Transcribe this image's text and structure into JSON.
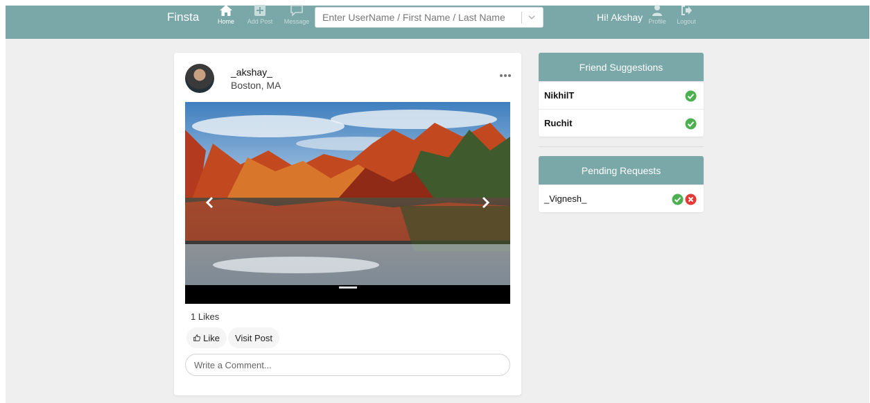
{
  "nav": {
    "brand": "Finsta",
    "items": [
      {
        "label": "Home",
        "icon": "home-icon",
        "active": true
      },
      {
        "label": "Add Post",
        "icon": "plus-square-icon",
        "active": false
      },
      {
        "label": "Message",
        "icon": "message-icon",
        "active": false
      },
      {
        "label": "Profile",
        "icon": "user-icon",
        "active": false
      },
      {
        "label": "Logout",
        "icon": "logout-icon",
        "active": false
      }
    ],
    "search_placeholder": "Enter UserName / First Name / Last Name",
    "greeting": "Hi! Akshay"
  },
  "post": {
    "username": "_akshay_",
    "location": "Boston, MA",
    "likes_text": "1 Likes",
    "like_label": "Like",
    "visit_label": "Visit Post",
    "comment_placeholder": "Write a Comment..."
  },
  "friend_suggestions": {
    "title": "Friend Suggestions",
    "items": [
      {
        "name": "NikhilT"
      },
      {
        "name": "Ruchit"
      }
    ]
  },
  "pending_requests": {
    "title": "Pending Requests",
    "items": [
      {
        "name": "_Vignesh_"
      }
    ]
  },
  "colors": {
    "navbar": "#7aa7a8",
    "accept": "#4caf50",
    "reject": "#e53935",
    "background": "#efefef"
  }
}
